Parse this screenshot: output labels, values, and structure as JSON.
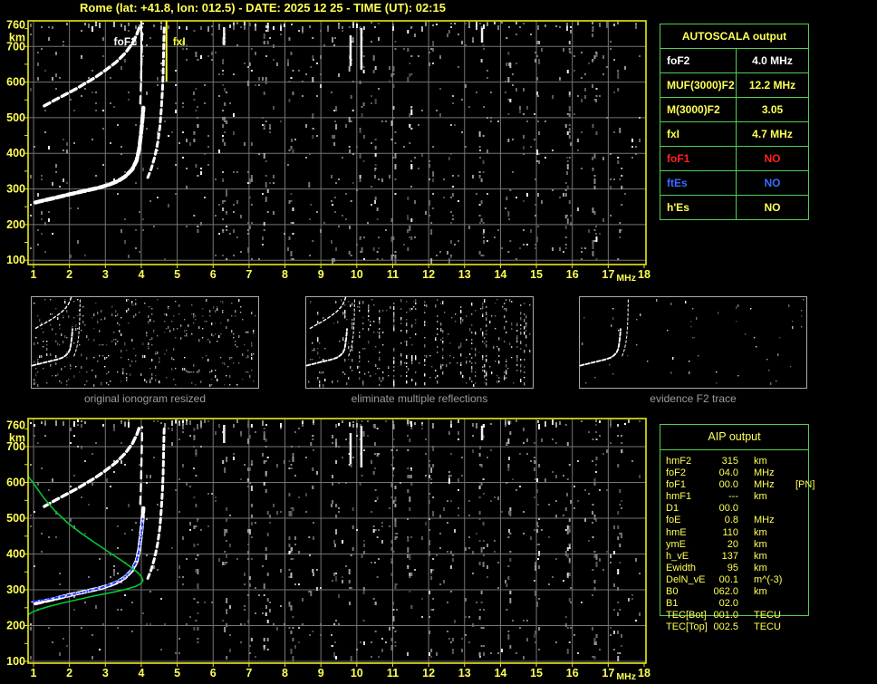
{
  "page": {
    "title": "Rome (lat: +41.8, lon: 012.5) - DATE: 2025 12 25 - TIME (UT): 02:15"
  },
  "colors": {
    "background": "#000000",
    "accent_yellow": "#ffff55",
    "plot_border_yellow": "#e8e818",
    "grid_gray": "#757575",
    "table_border_green": "#50d050",
    "text_white": "#ffffff",
    "text_red": "#ff2020",
    "text_blue": "#3a6cff",
    "thumb_label_gray": "#9c9c9c",
    "trace_white": "#ffffff",
    "profile_green": "#00c832",
    "fit_blue": "#2636ff"
  },
  "autoscala": {
    "header": "AUTOSCALA output",
    "rows": [
      {
        "label": "foF2",
        "value": "4.0 MHz",
        "color": "#ffffff"
      },
      {
        "label": "MUF(3000)F2",
        "value": "12.2 MHz",
        "color": "#ffff55"
      },
      {
        "label": "M(3000)F2",
        "value": "3.05",
        "color": "#ffff55"
      },
      {
        "label": "fxI",
        "value": "4.7 MHz",
        "color": "#ffff55"
      },
      {
        "label": "foF1",
        "value": "NO",
        "color": "#ff2020"
      },
      {
        "label": "ftEs",
        "value": "NO",
        "color": "#3a6cff"
      },
      {
        "label": "h'Es",
        "value": "NO",
        "color": "#ffff55"
      }
    ]
  },
  "aip": {
    "header": "AIP output",
    "rows": [
      {
        "name": "hmF2",
        "value": "315",
        "unit": "km",
        "extra": ""
      },
      {
        "name": "foF2",
        "value": "04.0",
        "unit": "MHz",
        "extra": ""
      },
      {
        "name": "foF1",
        "value": "00.0",
        "unit": "MHz",
        "extra": "[PN]"
      },
      {
        "name": "hmF1",
        "value": "---",
        "unit": "km",
        "extra": ""
      },
      {
        "name": "D1",
        "value": "00.0",
        "unit": "",
        "extra": ""
      },
      {
        "name": "foE",
        "value": "0.8",
        "unit": "MHz",
        "extra": ""
      },
      {
        "name": "hmE",
        "value": "110",
        "unit": "km",
        "extra": ""
      },
      {
        "name": "ymE",
        "value": "20",
        "unit": "km",
        "extra": ""
      },
      {
        "name": "h_vE",
        "value": "137",
        "unit": "km",
        "extra": ""
      },
      {
        "name": "Ewidth",
        "value": "95",
        "unit": "km",
        "extra": ""
      },
      {
        "name": "DelN_vE",
        "value": "00.1",
        "unit": "m^(-3)",
        "extra": ""
      },
      {
        "name": "B0",
        "value": "062.0",
        "unit": "km",
        "extra": ""
      },
      {
        "name": "B1",
        "value": "02.0",
        "unit": "",
        "extra": ""
      },
      {
        "name": "TEC[Bot]",
        "value": "001.0",
        "unit": "TECU",
        "extra": ""
      },
      {
        "name": "TEC[Top]",
        "value": "002.5",
        "unit": "TECU",
        "extra": ""
      }
    ]
  },
  "thumbnails": [
    {
      "label": "original ionogram resized"
    },
    {
      "label": "eliminate multiple reflections"
    },
    {
      "label": "evidence F2 trace"
    }
  ],
  "chart_data": [
    {
      "id": "ionogram_top",
      "type": "scatter",
      "title": "ionogram with AUTOSCALA frequency markers",
      "xlabel": "MHz",
      "ylabel": "km",
      "xlim": [
        1,
        18
      ],
      "ylim": [
        100,
        760
      ],
      "x_ticks": [
        1,
        2,
        3,
        4,
        5,
        6,
        7,
        8,
        9,
        10,
        11,
        12,
        13,
        14,
        15,
        16,
        17,
        18
      ],
      "y_ticks": [
        760,
        700,
        600,
        500,
        400,
        300,
        200,
        100
      ],
      "grid": true,
      "markers": [
        {
          "name": "foF2",
          "MHz": 4.0,
          "color": "#ffffff"
        },
        {
          "name": "fxI",
          "MHz": 4.7,
          "color": "#ffff33"
        }
      ],
      "rfi_bands_MHz": [
        5.5,
        6.3,
        7.0,
        7.45,
        8.15,
        8.7,
        9.35,
        9.82,
        10.12,
        10.5,
        11.0,
        11.45,
        12.05,
        12.6,
        13.45,
        14.2,
        15.0,
        15.85,
        16.6,
        17.3
      ],
      "series": [
        {
          "name": "F2 trace 1st hop (o-mode)",
          "color": "#ffffff",
          "points": [
            [
              1.05,
              262
            ],
            [
              1.3,
              268
            ],
            [
              1.6,
              275
            ],
            [
              2.0,
              285
            ],
            [
              2.4,
              294
            ],
            [
              2.8,
              303
            ],
            [
              3.1,
              312
            ],
            [
              3.35,
              322
            ],
            [
              3.55,
              335
            ],
            [
              3.75,
              355
            ],
            [
              3.87,
              380
            ],
            [
              3.94,
              412
            ],
            [
              3.99,
              452
            ],
            [
              4.03,
              492
            ],
            [
              4.06,
              528
            ]
          ]
        },
        {
          "name": "F2 trace x-mode",
          "color": "#ffffff",
          "points": [
            [
              4.18,
              332
            ],
            [
              4.28,
              357
            ],
            [
              4.38,
              392
            ],
            [
              4.46,
              432
            ],
            [
              4.52,
              477
            ],
            [
              4.56,
              527
            ],
            [
              4.59,
              577
            ],
            [
              4.61,
              627
            ],
            [
              4.62,
              677
            ],
            [
              4.63,
              722
            ],
            [
              4.64,
              756
            ]
          ]
        },
        {
          "name": "F2 trace 2nd hop",
          "color": "#ffffff",
          "points": [
            [
              1.3,
              533
            ],
            [
              1.6,
              550
            ],
            [
              1.9,
              566
            ],
            [
              2.2,
              582
            ],
            [
              2.45,
              597
            ],
            [
              2.7,
              612
            ],
            [
              3.0,
              633
            ],
            [
              3.3,
              656
            ],
            [
              3.55,
              681
            ],
            [
              3.75,
              708
            ],
            [
              3.88,
              735
            ],
            [
              3.96,
              758
            ]
          ]
        },
        {
          "name": "2nd hop asymptote",
          "color": "#ffffff",
          "points": [
            [
              3.97,
              540
            ],
            [
              3.99,
              585
            ],
            [
              4.0,
              630
            ],
            [
              4.01,
              675
            ],
            [
              4.02,
              720
            ],
            [
              4.02,
              755
            ]
          ]
        }
      ]
    },
    {
      "id": "ionogram_bottom",
      "type": "scatter",
      "title": "ionogram with AIP fitted trace and electron density profile",
      "xlabel": "MHz",
      "ylabel": "km",
      "xlim": [
        1,
        18
      ],
      "ylim": [
        100,
        760
      ],
      "x_ticks": [
        1,
        2,
        3,
        4,
        5,
        6,
        7,
        8,
        9,
        10,
        11,
        12,
        13,
        14,
        15,
        16,
        17,
        18
      ],
      "y_ticks": [
        760,
        700,
        600,
        500,
        400,
        300,
        200,
        100
      ],
      "grid": true,
      "markers": [],
      "rfi_bands_MHz": [
        5.5,
        6.3,
        7.0,
        7.45,
        8.15,
        8.7,
        9.35,
        9.82,
        10.12,
        10.5,
        11.0,
        11.45,
        12.05,
        12.6,
        13.45,
        14.2,
        15.0,
        15.85,
        16.6,
        17.3
      ],
      "series": [
        {
          "name": "F2 trace 1st hop (o-mode)",
          "color": "#ffffff",
          "points": [
            [
              1.05,
              262
            ],
            [
              1.3,
              268
            ],
            [
              1.6,
              275
            ],
            [
              2.0,
              285
            ],
            [
              2.4,
              294
            ],
            [
              2.8,
              303
            ],
            [
              3.1,
              312
            ],
            [
              3.35,
              322
            ],
            [
              3.55,
              335
            ],
            [
              3.75,
              355
            ],
            [
              3.87,
              380
            ],
            [
              3.94,
              412
            ],
            [
              3.99,
              452
            ],
            [
              4.03,
              492
            ],
            [
              4.06,
              528
            ]
          ]
        },
        {
          "name": "F2 trace x-mode",
          "color": "#ffffff",
          "points": [
            [
              4.18,
              332
            ],
            [
              4.28,
              357
            ],
            [
              4.38,
              392
            ],
            [
              4.46,
              432
            ],
            [
              4.52,
              477
            ],
            [
              4.56,
              527
            ],
            [
              4.59,
              577
            ],
            [
              4.61,
              627
            ],
            [
              4.62,
              677
            ],
            [
              4.63,
              722
            ],
            [
              4.64,
              756
            ]
          ]
        },
        {
          "name": "F2 trace 2nd hop",
          "color": "#ffffff",
          "points": [
            [
              1.3,
              533
            ],
            [
              1.6,
              550
            ],
            [
              1.9,
              566
            ],
            [
              2.2,
              582
            ],
            [
              2.45,
              597
            ],
            [
              2.7,
              612
            ],
            [
              3.0,
              633
            ],
            [
              3.3,
              656
            ],
            [
              3.55,
              681
            ],
            [
              3.75,
              708
            ],
            [
              3.88,
              735
            ],
            [
              3.96,
              758
            ]
          ]
        },
        {
          "name": "2nd hop asymptote",
          "color": "#ffffff",
          "points": [
            [
              3.97,
              540
            ],
            [
              3.99,
              585
            ],
            [
              4.0,
              630
            ],
            [
              4.01,
              675
            ],
            [
              4.02,
              720
            ],
            [
              4.02,
              755
            ]
          ]
        },
        {
          "name": "AIP fitted h'(f) trace",
          "color": "#2636ff",
          "points": [
            [
              0.95,
              266
            ],
            [
              1.4,
              274
            ],
            [
              1.9,
              283
            ],
            [
              2.4,
              294
            ],
            [
              2.9,
              306
            ],
            [
              3.2,
              317
            ],
            [
              3.5,
              332
            ],
            [
              3.7,
              351
            ],
            [
              3.85,
              376
            ],
            [
              3.93,
              405
            ],
            [
              3.98,
              440
            ],
            [
              4.02,
              472
            ],
            [
              4.04,
              498
            ]
          ]
        },
        {
          "name": "electron density profile (plasma frequency vs height)",
          "color": "#00c832",
          "points": [
            [
              0.86,
              616
            ],
            [
              1.05,
              590
            ],
            [
              1.3,
              555
            ],
            [
              1.6,
              520
            ],
            [
              1.95,
              487
            ],
            [
              2.3,
              460
            ],
            [
              2.7,
              432
            ],
            [
              3.1,
              405
            ],
            [
              3.45,
              382
            ],
            [
              3.7,
              364
            ],
            [
              3.9,
              348
            ],
            [
              4.0,
              337
            ],
            [
              4.05,
              327
            ],
            [
              4.0,
              318
            ],
            [
              3.85,
              310
            ],
            [
              3.6,
              302
            ],
            [
              3.3,
              295
            ],
            [
              2.95,
              288
            ],
            [
              2.6,
              281
            ],
            [
              2.2,
              272
            ],
            [
              1.8,
              263
            ],
            [
              1.45,
              254
            ],
            [
              1.15,
              245
            ],
            [
              0.95,
              237
            ],
            [
              0.86,
              231
            ]
          ]
        }
      ]
    }
  ]
}
